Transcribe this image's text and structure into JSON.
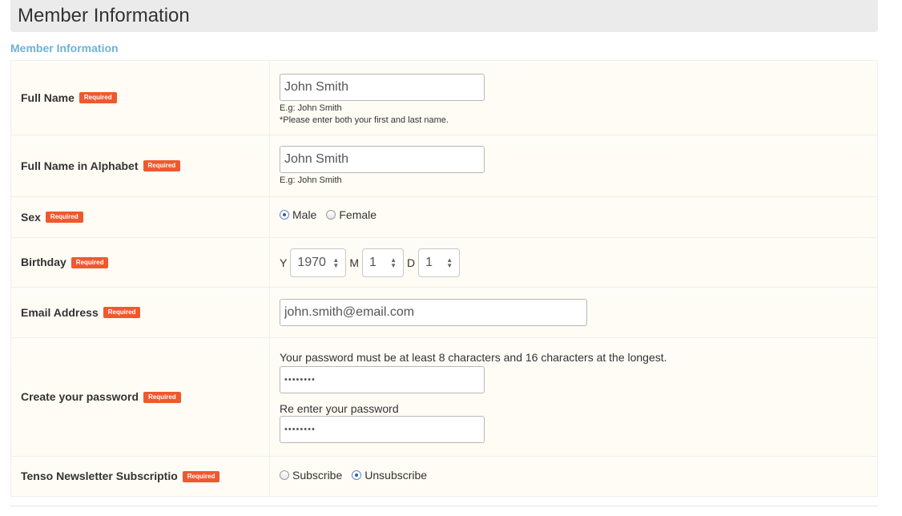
{
  "header": {
    "title": "Member Information"
  },
  "section": {
    "title": "Member Information"
  },
  "required_label": "Required",
  "fields": {
    "full_name": {
      "label": "Full Name",
      "value": "John Smith",
      "hint1": "E.g: John Smith",
      "hint2": "*Please enter both your first and last name."
    },
    "alpha_name": {
      "label": "Full Name in Alphabet",
      "value": "John Smith",
      "hint1": "E.g: John Smith"
    },
    "sex": {
      "label": "Sex",
      "options": [
        "Male",
        "Female"
      ],
      "selected": "Male"
    },
    "birthday": {
      "label": "Birthday",
      "y_label": "Y",
      "year": "1970",
      "m_label": "M",
      "month": "1",
      "d_label": "D",
      "day": "1"
    },
    "email": {
      "label": "Email Address",
      "value": "john.smith@email.com"
    },
    "password": {
      "label": "Create your password",
      "note": "Your password must be at least 8 characters and 16 characters at the longest.",
      "value": "••••••••",
      "reenter_label": "Re enter your password",
      "reenter_value": "••••••••"
    },
    "newsletter": {
      "label": "Tenso Newsletter Subscriptio",
      "options": [
        "Subscribe",
        "Unsubscribe"
      ],
      "selected": "Unsubscribe"
    }
  },
  "colors": {
    "required_badge": "#f0582f",
    "section_title": "#6bb3d6",
    "header_bg": "#ebebeb"
  }
}
